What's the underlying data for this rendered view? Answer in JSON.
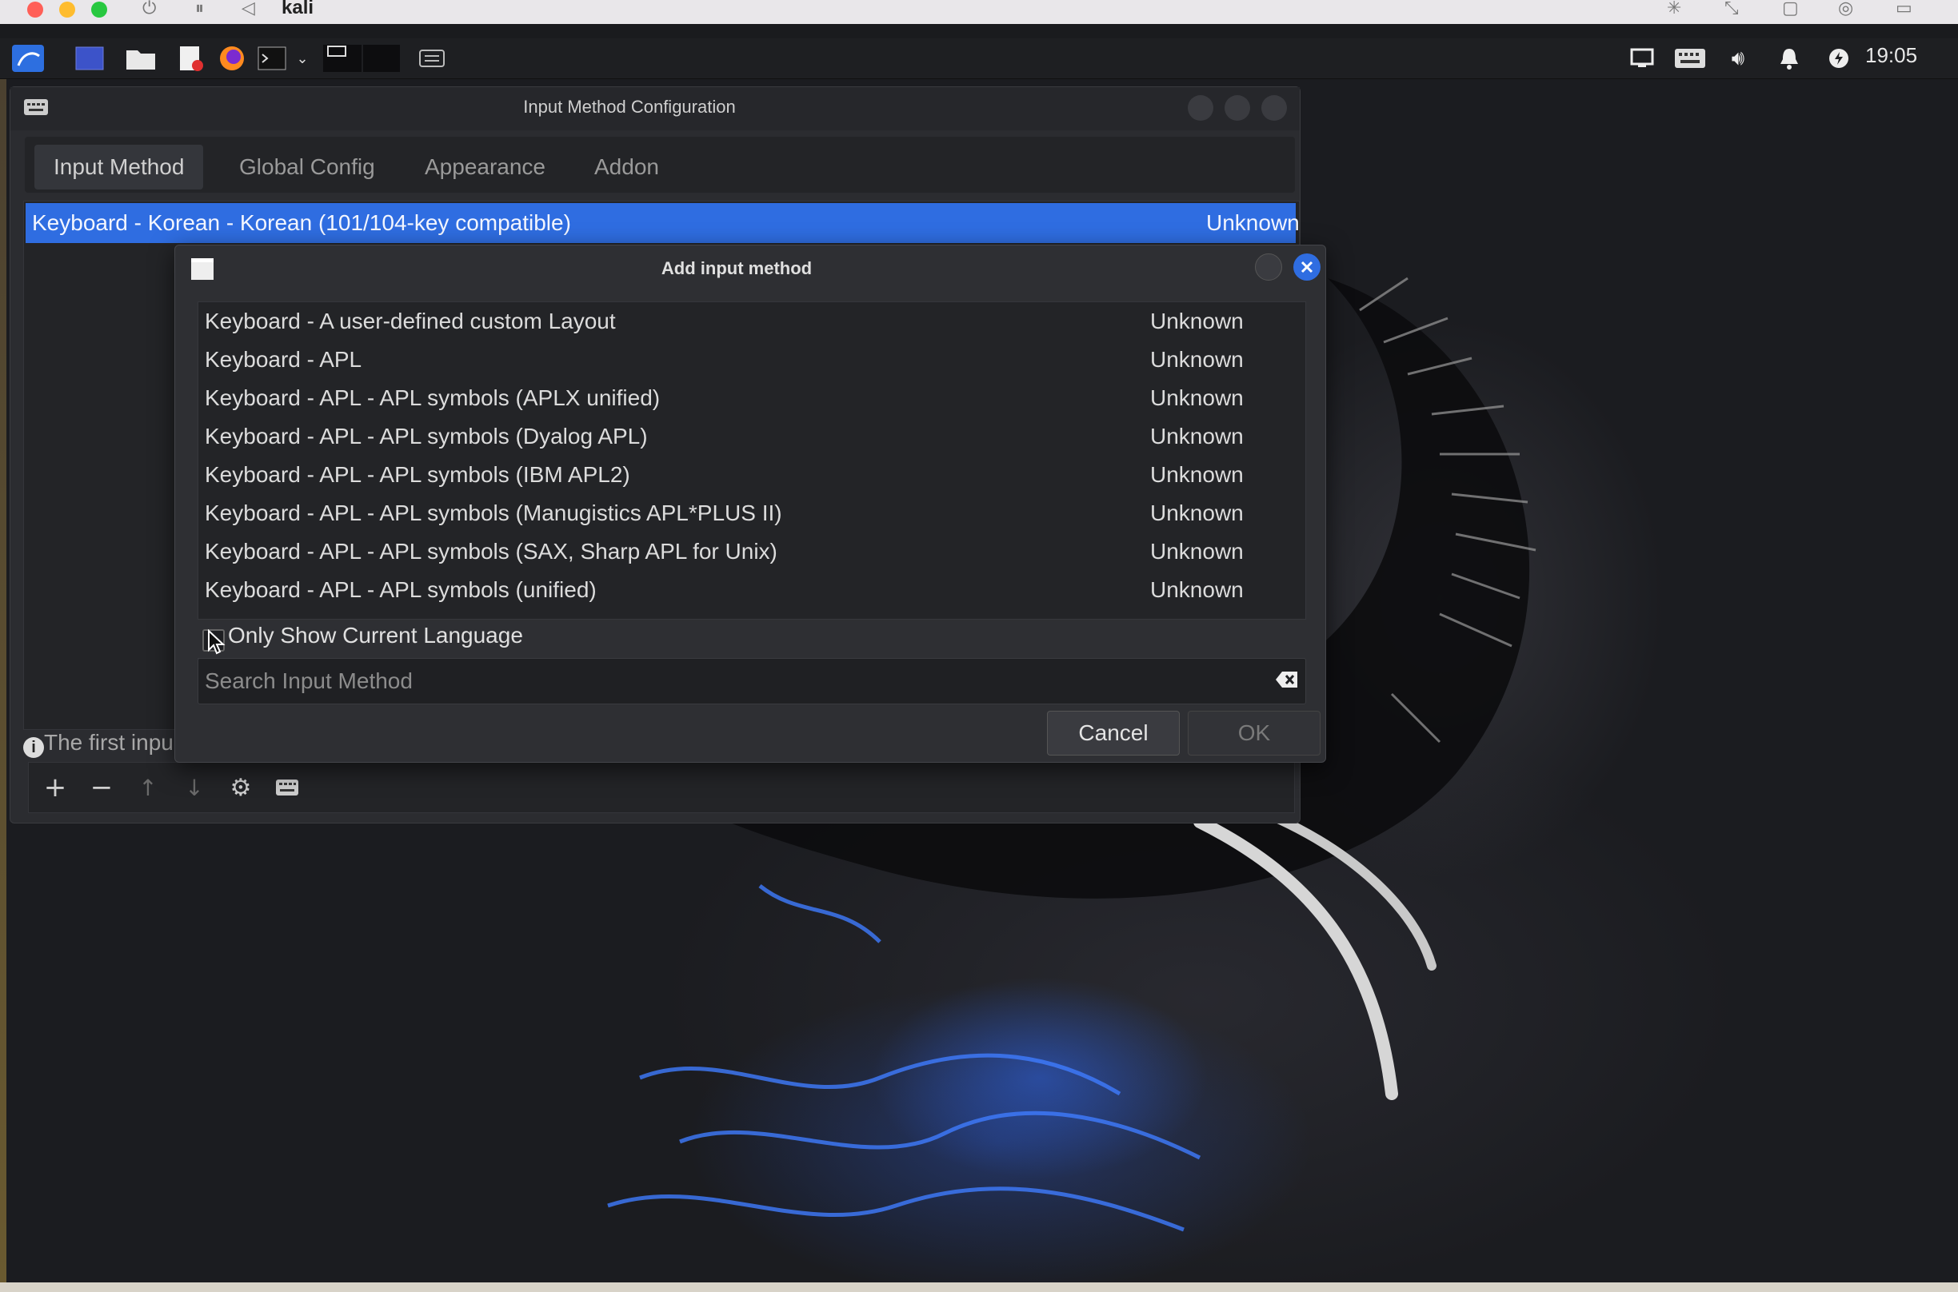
{
  "host": {
    "title": "kali"
  },
  "panel": {
    "clock": "19:05"
  },
  "main_window": {
    "title": "Input Method Configuration",
    "tabs": [
      {
        "label": "Input Method"
      },
      {
        "label": "Global Config"
      },
      {
        "label": "Appearance"
      },
      {
        "label": "Addon"
      }
    ],
    "selected_item": {
      "name": "Keyboard - Korean - Korean (101/104-key compatible)",
      "status": "Unknown"
    },
    "info_text": "The first inpu"
  },
  "dialog": {
    "title": "Add input method",
    "rows": [
      {
        "name": "Keyboard - A user-defined custom Layout",
        "status": "Unknown"
      },
      {
        "name": "Keyboard - APL",
        "status": "Unknown"
      },
      {
        "name": "Keyboard - APL - APL symbols (APLX unified)",
        "status": "Unknown"
      },
      {
        "name": "Keyboard - APL - APL symbols (Dyalog APL)",
        "status": "Unknown"
      },
      {
        "name": "Keyboard - APL - APL symbols (IBM APL2)",
        "status": "Unknown"
      },
      {
        "name": "Keyboard - APL - APL symbols (Manugistics APL*PLUS II)",
        "status": "Unknown"
      },
      {
        "name": "Keyboard - APL - APL symbols (SAX, Sharp APL for Unix)",
        "status": "Unknown"
      },
      {
        "name": "Keyboard - APL - APL symbols (unified)",
        "status": "Unknown"
      }
    ],
    "only_current_label": "Only Show Current Language",
    "search_placeholder": "Search Input Method",
    "search_value": "",
    "cancel_label": "Cancel",
    "ok_label": "OK"
  },
  "colors": {
    "selection": "#2f6de1",
    "close_button": "#2f6de1"
  }
}
